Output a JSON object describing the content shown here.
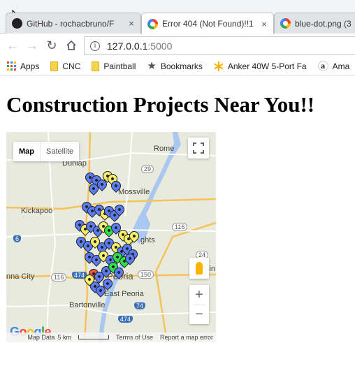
{
  "browser": {
    "tabs": [
      {
        "title": "GitHub - rochacbruno/F",
        "icon": "github-icon",
        "active": false
      },
      {
        "title": "Error 404 (Not Found)!!1",
        "icon": "google-icon",
        "active": true
      },
      {
        "title": "blue-dot.png (3",
        "icon": "google-icon",
        "active": false
      }
    ],
    "close_glyph": "×",
    "url_host": "127.0.0.1",
    "url_port": ":5000",
    "bookmarks": [
      {
        "label": "Apps",
        "icon": "apps-grid-icon"
      },
      {
        "label": "CNC",
        "icon": "folder-icon"
      },
      {
        "label": "Paintball",
        "icon": "folder-icon"
      },
      {
        "label": "Bookmarks",
        "icon": "star-icon"
      },
      {
        "label": "Anker 40W 5-Port Fa",
        "icon": "anker-icon"
      },
      {
        "label": "Ama",
        "icon": "amazon-icon"
      }
    ]
  },
  "page": {
    "title": "Construction Projects Near You!!"
  },
  "map": {
    "type_buttons": {
      "map": "Map",
      "satellite": "Satellite"
    },
    "place_labels": {
      "rome": "Rome",
      "dunlap": "Dunlap",
      "mossville": "Mossville",
      "kickapoo": "Kickapoo",
      "heights": "ghts",
      "peoria": "Peoria",
      "edwards": "nna City",
      "east_peoria": "East Peoria",
      "bartonville": "Bartonville",
      "hamlet": "lin"
    },
    "route_shields": [
      "29",
      "116",
      "6",
      "24",
      "150",
      "74",
      "116",
      "474",
      "474"
    ],
    "zoom_in": "+",
    "zoom_out": "−",
    "footer": {
      "map_data": "Map Data",
      "scale": "5 km",
      "terms": "Terms of Use",
      "report": "Report a map error"
    },
    "marker_colors": {
      "blue": "#5b7cf5",
      "yellow": "#f8ef6a",
      "green": "#2ee04a",
      "red": "#e85a3c"
    }
  }
}
